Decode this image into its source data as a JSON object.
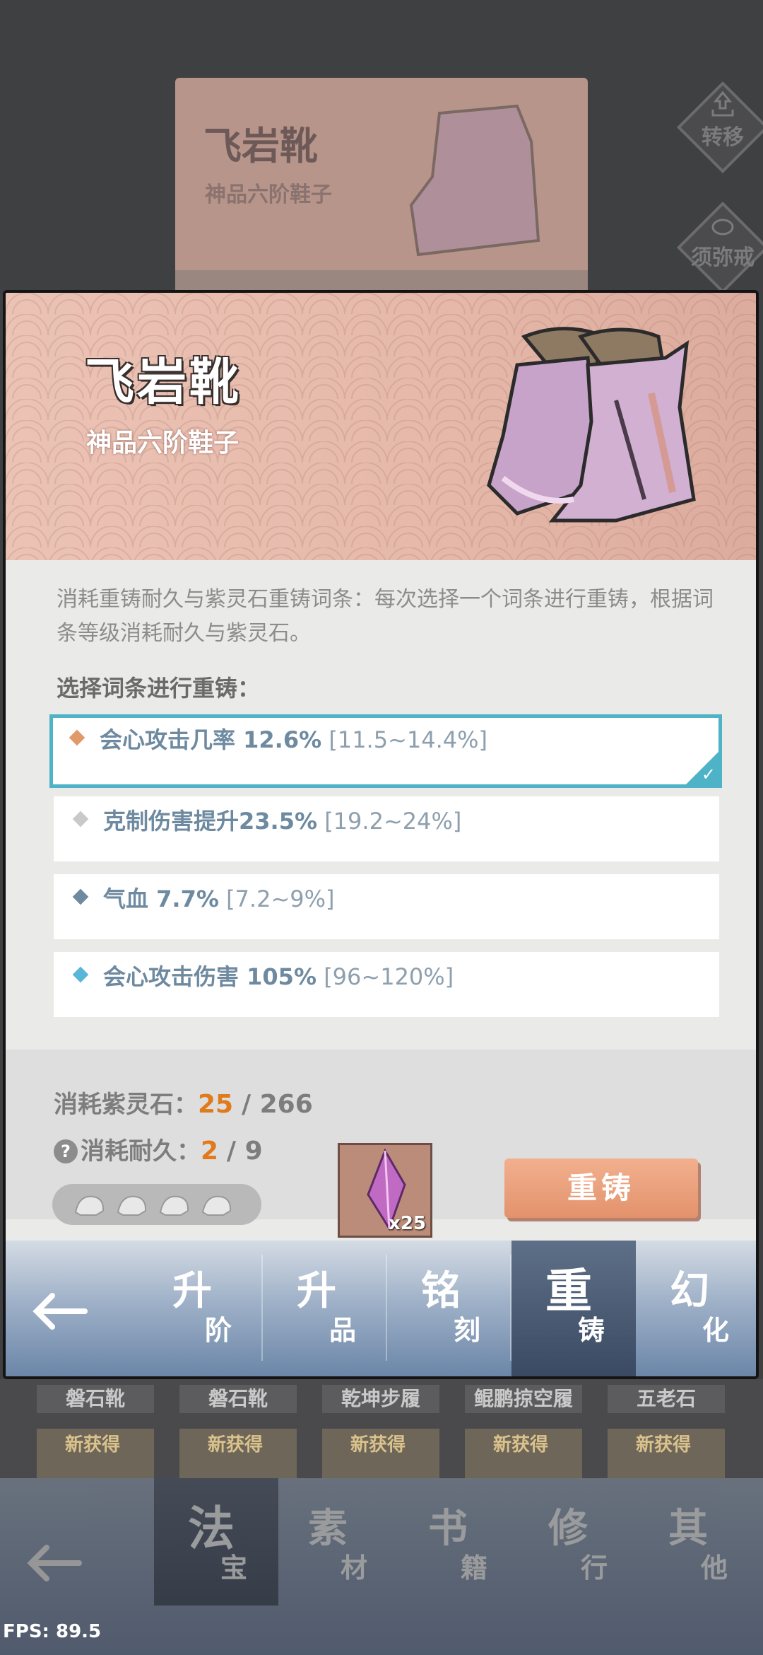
{
  "background": {
    "card_title": "飞岩靴",
    "card_subtitle": "神品六阶鞋子",
    "transfer_label": "转移",
    "sumeru_label": "须弥戒"
  },
  "item": {
    "name": "飞岩靴",
    "grade": "神品六阶鞋子"
  },
  "description": "消耗重铸耐久与紫灵石重铸词条：每次选择一个词条进行重铸，根据词条等级消耗耐久与紫灵石。",
  "select_label": "选择词条进行重铸：",
  "affixes": [
    {
      "text": "会心攻击几率 12.6%",
      "range": "[11.5~14.4%]",
      "color": "#e09a6a"
    },
    {
      "text": "克制伤害提升23.5%",
      "range": "[19.2~24%]",
      "color": "#c9c9c9"
    },
    {
      "text": "气血 7.7%",
      "range": "[7.2~9%]",
      "color": "#6e8aa0"
    },
    {
      "text": "会心攻击伤害 105%",
      "range": "[96~120%]",
      "color": "#59b6d8"
    }
  ],
  "cost": {
    "stone_label": "消耗紫灵石：",
    "stone_used": "25",
    "stone_total": "/ 266",
    "durability_label": "消耗耐久：",
    "durability_used": "2",
    "durability_total": "/ 9",
    "help_icon": "?",
    "stone_count": "x25"
  },
  "recast_button": "重铸",
  "tabs": [
    {
      "big": "升",
      "small": "阶"
    },
    {
      "big": "升",
      "small": "品"
    },
    {
      "big": "铭",
      "small": "刻"
    },
    {
      "big": "重",
      "small": "铸"
    },
    {
      "big": "幻",
      "small": "化"
    }
  ],
  "inventory": [
    {
      "name": "磐石靴",
      "tag": "新获得"
    },
    {
      "name": "磐石靴",
      "tag": "新获得"
    },
    {
      "name": "乾坤步履",
      "tag": "新获得"
    },
    {
      "name": "鲲鹏掠空履",
      "tag": "新获得"
    },
    {
      "name": "五老石",
      "tag": "新获得"
    }
  ],
  "outer_tabs": [
    {
      "big": "法",
      "small": "宝"
    },
    {
      "big": "素",
      "small": "材"
    },
    {
      "big": "书",
      "small": "籍"
    },
    {
      "big": "修",
      "small": "行"
    },
    {
      "big": "其",
      "small": "他"
    }
  ],
  "fps": "FPS: 89.5",
  "colors": {
    "accent": "#4eb3c6",
    "cost_highlight": "#e07a1d",
    "button": "#e9a07c"
  }
}
